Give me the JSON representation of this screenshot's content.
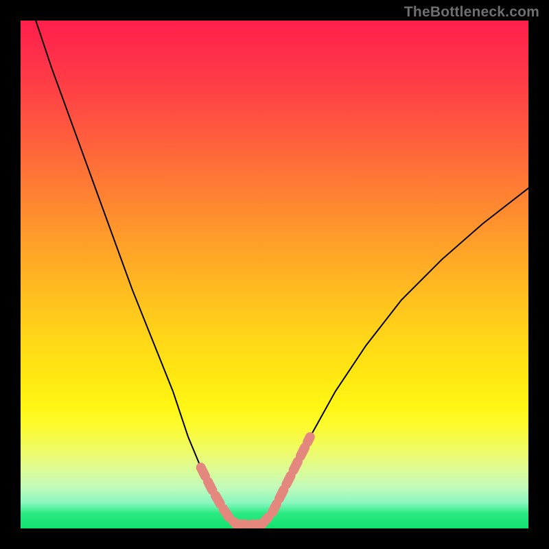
{
  "watermark": {
    "text": "TheBottleneck.com"
  },
  "chart_data": {
    "type": "line",
    "title": "",
    "xlabel": "",
    "ylabel": "",
    "xlim": [
      0,
      100
    ],
    "ylim": [
      0,
      100
    ],
    "grid": false,
    "legend": false,
    "series": [
      {
        "name": "left-curve",
        "x": [
          3,
          6,
          10,
          14,
          18,
          22,
          26,
          30,
          33,
          35.5,
          37.5,
          39.5,
          41,
          42.5
        ],
        "y": [
          100,
          91,
          80,
          69,
          58,
          47,
          37,
          27,
          18,
          12,
          8,
          4.5,
          2.2,
          0.8
        ]
      },
      {
        "name": "right-curve",
        "x": [
          47.5,
          49.5,
          53,
          57,
          62,
          68,
          75,
          83,
          91,
          100
        ],
        "y": [
          0.8,
          3,
          10,
          18,
          27,
          36,
          45,
          53,
          60,
          67
        ]
      },
      {
        "name": "valley-floor",
        "x": [
          42.5,
          47.5
        ],
        "y": [
          0.8,
          0.8
        ]
      }
    ],
    "annotations": {
      "beaded_segments": [
        {
          "along": "left-curve",
          "x_range": [
            35.5,
            42.5
          ]
        },
        {
          "along": "valley-floor",
          "x_range": [
            42.5,
            47.5
          ]
        },
        {
          "along": "right-curve",
          "x_range": [
            47.5,
            57
          ]
        }
      ],
      "bead_color": "#e4887f",
      "curve_color": "#000000"
    },
    "background_gradient": {
      "direction": "vertical",
      "stops": [
        {
          "pos": 0.0,
          "color": "#ff1f4b"
        },
        {
          "pos": 0.5,
          "color": "#ffbe1f"
        },
        {
          "pos": 0.8,
          "color": "#fbfb2f"
        },
        {
          "pos": 1.0,
          "color": "#11e06e"
        }
      ]
    }
  }
}
